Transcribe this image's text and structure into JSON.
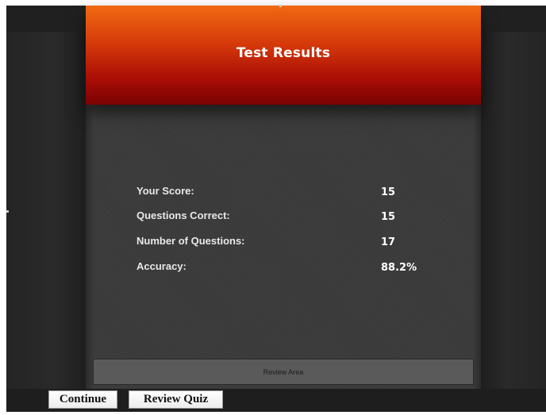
{
  "header": {
    "title": "Test Results"
  },
  "results": [
    {
      "label": "Your Score:",
      "value": "15"
    },
    {
      "label": "Questions Correct:",
      "value": "15"
    },
    {
      "label": "Number of Questions:",
      "value": "17"
    },
    {
      "label": "Accuracy:",
      "value": "88.2%"
    }
  ],
  "review_area": {
    "label": "Review Area"
  },
  "buttons": {
    "continue_label": "Continue",
    "review_quiz_label": "Review Quiz"
  },
  "colors": {
    "header_top": "#f06a12",
    "header_bottom": "#7a0303",
    "panel": "#3b3b3b",
    "background": "#1a1a1a"
  }
}
